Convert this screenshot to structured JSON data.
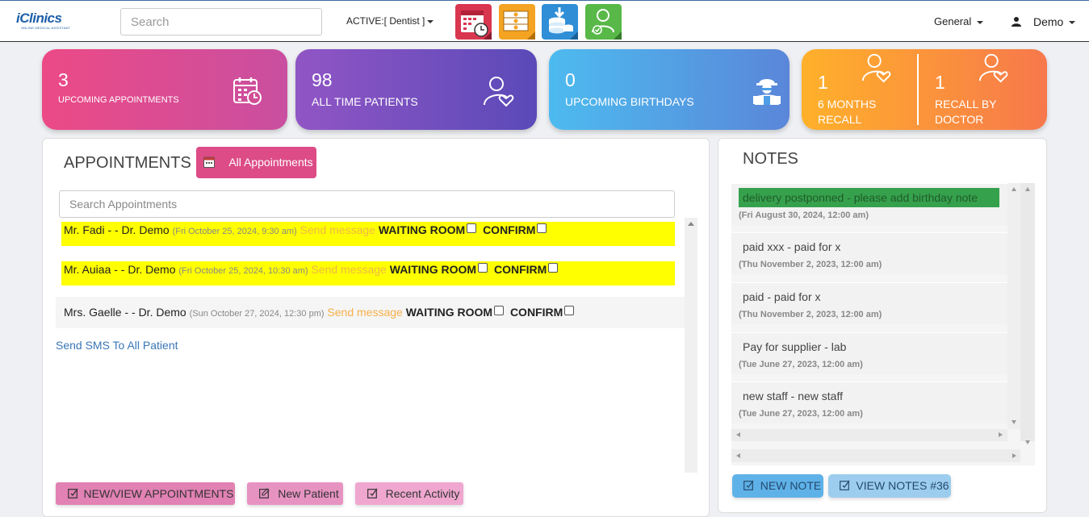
{
  "app": {
    "logo_text": "iClinics",
    "logo_tagline": "ONLINE MEDICAL ASSISTANT"
  },
  "topbar": {
    "search_placeholder": "Search",
    "active_label": "ACTIVE:[ Dentist ]",
    "general_label": "General",
    "user_label": "Demo",
    "quick_icons": [
      "calendar-clock-icon",
      "money-stack-icon",
      "database-download-icon",
      "user-check-icon"
    ],
    "quick_colors": [
      "#d93650",
      "#f4a322",
      "#2f8ed6",
      "#58b848"
    ]
  },
  "stats": {
    "upcoming_appointments": {
      "value": "3",
      "label": "UPCOMING APPOINTMENTS"
    },
    "all_time_patients": {
      "value": "98",
      "label": "ALL TIME PATIENTS"
    },
    "upcoming_birthdays": {
      "value": "0",
      "label": "UPCOMING BIRTHDAYS"
    },
    "six_months_recall": {
      "value": "1",
      "label_line1": "6 MONTHS",
      "label_line2": "RECALL"
    },
    "recall_by_doctor": {
      "value": "1",
      "label_line1": "RECALL BY",
      "label_line2": "DOCTOR"
    }
  },
  "appointments": {
    "title": "APPOINTMENTS",
    "all_button": "All Appointments",
    "search_placeholder": "Search Appointments",
    "rows": [
      {
        "patient": "Mr. Fadi - - Dr. Demo",
        "datetime": "(Fri October 25, 2024, 9:30 am)",
        "send": "Send message",
        "waiting": "WAITING ROOM",
        "confirm": "CONFIRM",
        "highlight": "yellow"
      },
      {
        "patient": "Mr. Auiaa - - Dr. Demo",
        "datetime": "(Fri October 25, 2024, 10:30 am)",
        "send": "Send message",
        "waiting": "WAITING ROOM",
        "confirm": "CONFIRM",
        "highlight": "yellow"
      },
      {
        "patient": "Mrs. Gaelle - - Dr. Demo",
        "datetime": "(Sun October 27, 2024, 12:30 pm)",
        "send": "Send message",
        "waiting": "WAITING ROOM",
        "confirm": "CONFIRM",
        "highlight": "none"
      }
    ],
    "sms_link": "Send SMS To All Patient",
    "buttons": {
      "new_view": "NEW/VIEW APPOINTMENTS",
      "new_patient": "New Patient",
      "recent_activity": "Recent Activity"
    }
  },
  "notes": {
    "title": "NOTES",
    "items": [
      {
        "text": "delivery postponned - please add birthday note",
        "date": "(Fri August 30, 2024, 12:00 am)",
        "highlight": "#36a14c"
      },
      {
        "text": "paid xxx - paid for x",
        "date": "(Thu November 2, 2023, 12:00 am)"
      },
      {
        "text": "paid - paid for x",
        "date": "(Thu November 2, 2023, 12:00 am)"
      },
      {
        "text": "Pay for supplier - lab",
        "date": "(Tue June 27, 2023, 12:00 am)"
      },
      {
        "text": "new staff - new staff",
        "date": "(Tue June 27, 2023, 12:00 am)"
      }
    ],
    "buttons": {
      "new_note": "NEW NOTE",
      "view_notes": "VIEW NOTES #36"
    }
  }
}
